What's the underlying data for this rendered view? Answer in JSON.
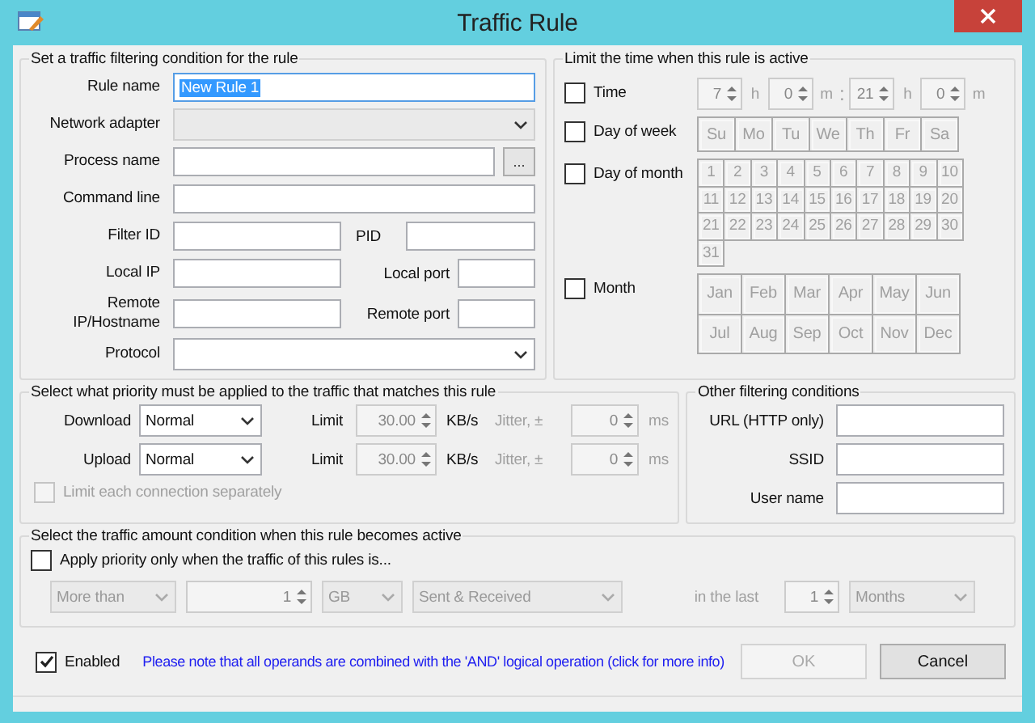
{
  "window": {
    "title": "Traffic Rule"
  },
  "filter": {
    "title": "Set a traffic filtering condition for the rule",
    "rule_name": {
      "label": "Rule name",
      "value": "New Rule 1",
      "selected": true
    },
    "network_adapter": {
      "label": "Network adapter",
      "disabled": true
    },
    "process_name": {
      "label": "Process name",
      "browse": "..."
    },
    "command_line": {
      "label": "Command line"
    },
    "filter_id": {
      "label": "Filter ID"
    },
    "pid": {
      "label": "PID"
    },
    "local_ip": {
      "label": "Local IP"
    },
    "local_port": {
      "label": "Local port"
    },
    "remote_ip": {
      "label": "Remote IP/Hostname"
    },
    "remote_port": {
      "label": "Remote port"
    },
    "protocol": {
      "label": "Protocol",
      "disabled": false
    }
  },
  "time_limit": {
    "title": "Limit the time when this rule is active",
    "time": {
      "label": "Time",
      "checked": false,
      "separator": ":",
      "fields": [
        {
          "value": "7",
          "unit": "h"
        },
        {
          "value": "0",
          "unit": "m"
        },
        {
          "value": "21",
          "unit": "h"
        },
        {
          "value": "0",
          "unit": "m"
        }
      ]
    },
    "day_of_week": {
      "label": "Day of week",
      "checked": false,
      "days": [
        "Su",
        "Mo",
        "Tu",
        "We",
        "Th",
        "Fr",
        "Sa"
      ]
    },
    "day_of_month": {
      "label": "Day of month",
      "checked": false,
      "days": [
        "1",
        "2",
        "3",
        "4",
        "5",
        "6",
        "7",
        "8",
        "9",
        "10",
        "11",
        "12",
        "13",
        "14",
        "15",
        "16",
        "17",
        "18",
        "19",
        "20",
        "21",
        "22",
        "23",
        "24",
        "25",
        "26",
        "27",
        "28",
        "29",
        "30",
        "31"
      ]
    },
    "month": {
      "label": "Month",
      "checked": false,
      "months": [
        "Jan",
        "Feb",
        "Mar",
        "Apr",
        "May",
        "Jun",
        "Jul",
        "Aug",
        "Sep",
        "Oct",
        "Nov",
        "Dec"
      ]
    }
  },
  "priority": {
    "title": "Select what priority must be applied to the traffic that matches this rule",
    "rows": [
      {
        "label": "Download",
        "value": "Normal",
        "limit_label": "Limit",
        "limit": "30.00",
        "unit": "KB/s",
        "jitter_label": "Jitter, ±",
        "jitter": "0",
        "jitter_unit": "ms"
      },
      {
        "label": "Upload",
        "value": "Normal",
        "limit_label": "Limit",
        "limit": "30.00",
        "unit": "KB/s",
        "jitter_label": "Jitter, ±",
        "jitter": "0",
        "jitter_unit": "ms"
      }
    ],
    "separate": {
      "label": "Limit each connection separately",
      "checked": false,
      "disabled": true
    }
  },
  "other": {
    "title": "Other filtering conditions",
    "fields": [
      {
        "label": "URL (HTTP only)"
      },
      {
        "label": "SSID"
      },
      {
        "label": "User name"
      }
    ]
  },
  "amount": {
    "title": "Select the traffic amount condition when this rule becomes active",
    "apply": {
      "label": "Apply priority only when the traffic of this rules is...",
      "checked": false
    },
    "comparison": "More than",
    "value": "1",
    "unit": "GB",
    "direction": "Sent & Received",
    "period_label": "in the last",
    "period": "1",
    "period_unit": "Months"
  },
  "footer": {
    "enabled": {
      "label": "Enabled",
      "checked": true
    },
    "note": "Please note that all operands are combined with the 'AND' logical operation (click for more info)",
    "buttons": [
      {
        "label": "OK",
        "disabled": true
      },
      {
        "label": "Cancel",
        "disabled": false
      }
    ]
  }
}
